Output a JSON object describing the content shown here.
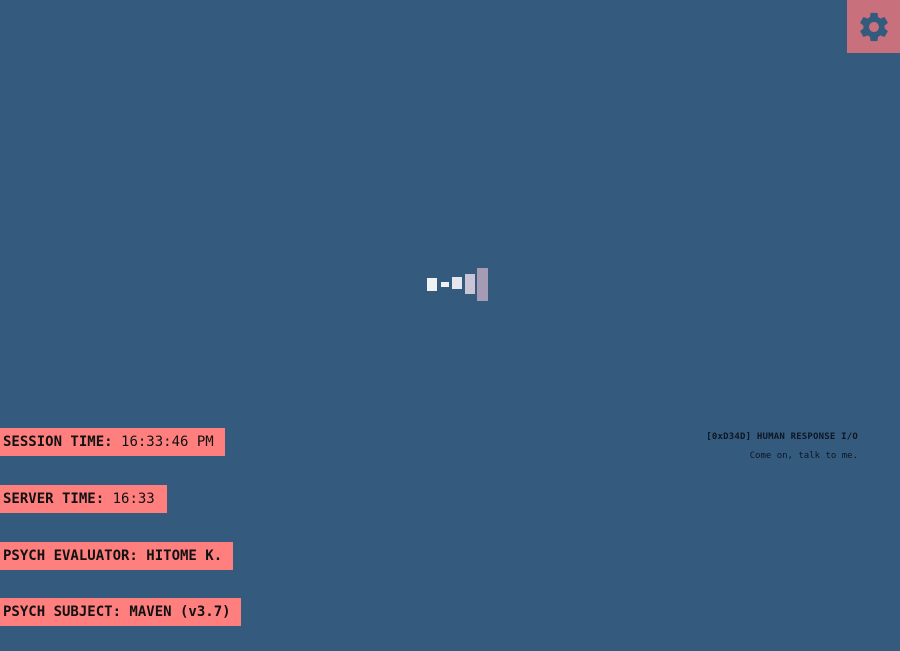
{
  "settings": {
    "icon": "gear-icon",
    "bg_color": "#c8707c"
  },
  "indicator": {
    "levels": [
      0.4,
      0.15,
      0.36,
      0.6,
      1.0
    ]
  },
  "io_panel": {
    "title": "[0xD34D] HUMAN RESPONSE I/O",
    "message": "Come on, talk to me."
  },
  "info": {
    "session": {
      "label": "SESSION TIME:",
      "value": "16:33:46 PM"
    },
    "server": {
      "label": "SERVER TIME:",
      "value": "16:33"
    },
    "evaluator": {
      "label": "PSYCH EVALUATOR: HITOME K."
    },
    "subject": {
      "label": "PSYCH SUBJECT: MAVEN (v3.7)"
    }
  },
  "colors": {
    "background": "#345b7e",
    "tag_bg": "#ff7f7f",
    "text_dark": "#0c1524"
  }
}
